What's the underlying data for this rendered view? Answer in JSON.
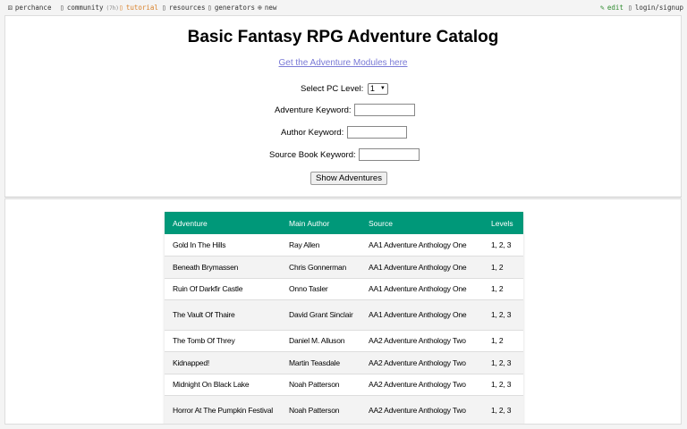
{
  "nav": {
    "perchance": "perchance",
    "community": "community",
    "community_badge": "(7h)",
    "tutorial": "tutorial",
    "resources": "resources",
    "generators": "generators",
    "new": "new",
    "edit": "edit",
    "login": "login/signup"
  },
  "header": {
    "title": "Basic Fantasy RPG Adventure Catalog",
    "modules_link": "Get the Adventure Modules here"
  },
  "form": {
    "pc_level_label": "Select PC Level:",
    "pc_level_value": "1",
    "adventure_keyword_label": "Adventure Keyword:",
    "adventure_keyword_value": "",
    "author_keyword_label": "Author Keyword:",
    "author_keyword_value": "",
    "source_keyword_label": "Source Book Keyword:",
    "source_keyword_value": "",
    "submit_label": "Show Adventures"
  },
  "table": {
    "columns": [
      "Adventure",
      "Main Author",
      "Source",
      "Levels"
    ],
    "rows": [
      [
        "Gold In The Hills",
        "Ray Allen",
        "AA1 Adventure Anthology One",
        "1, 2, 3"
      ],
      [
        "Beneath Brymassen",
        "Chris Gonnerman",
        "AA1 Adventure Anthology One",
        "1, 2"
      ],
      [
        "Ruin Of Darkfir Castle",
        "Onno Tasler",
        "AA1 Adventure Anthology One",
        "1, 2"
      ],
      [
        "The Vault Of Thaire",
        "David Grant Sinclair",
        "AA1 Adventure Anthology One",
        "1, 2, 3"
      ],
      [
        "The Tomb Of Threy",
        "Daniel M. Alluson",
        "AA2 Adventure Anthology Two",
        "1, 2"
      ],
      [
        "Kidnapped!",
        "Martin Teasdale",
        "AA2 Adventure Anthology Two",
        "1, 2, 3"
      ],
      [
        "Midnight On Black Lake",
        "Noah Patterson",
        "AA2 Adventure Anthology Two",
        "1, 2, 3"
      ],
      [
        "Horror At The Pumpkin Festival",
        "Noah Patterson",
        "AA2 Adventure Anthology Two",
        "1, 2, 3"
      ]
    ]
  },
  "colors": {
    "header_bg": "#009879",
    "accent_orange": "#d9822b",
    "accent_green": "#2e8b2e",
    "link": "#7a7ad6"
  }
}
